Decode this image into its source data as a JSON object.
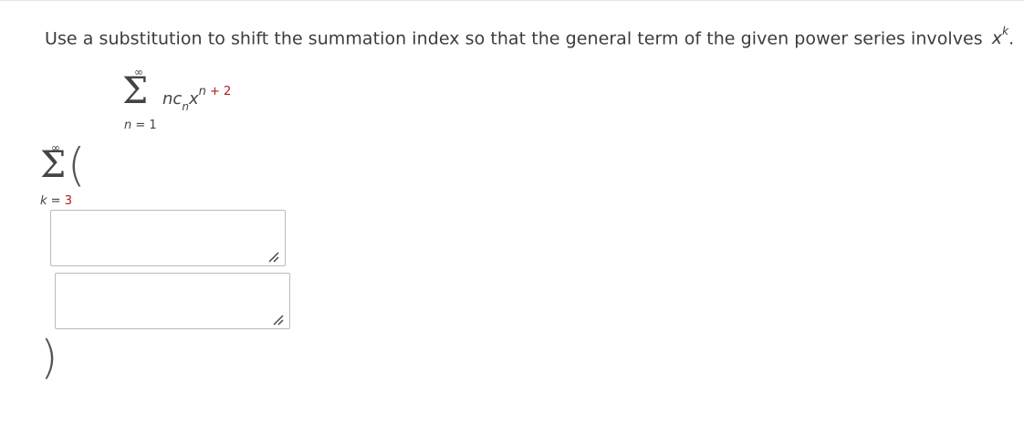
{
  "question": {
    "prompt": "Use a substitution to shift the summation index so that the general term of the given power series involves",
    "variable_base": "x",
    "variable_exponent": "k",
    "trailing_punct": "."
  },
  "given_series": {
    "upper_limit": "∞",
    "sigma": "Σ",
    "lower_var": "n",
    "lower_eq": " = 1",
    "term_coef": "n",
    "term_c": "c",
    "term_sub": "n",
    "term_x": "x",
    "term_exp_var": "n",
    "term_exp_rest": " + 2"
  },
  "answer_series": {
    "upper_limit": "∞",
    "sigma": "Σ",
    "open_paren": "(",
    "lower_var": "k",
    "lower_eq": " = ",
    "lower_value": "3",
    "close_paren": ")"
  },
  "inputs": {
    "first_value": "",
    "second_value": ""
  }
}
